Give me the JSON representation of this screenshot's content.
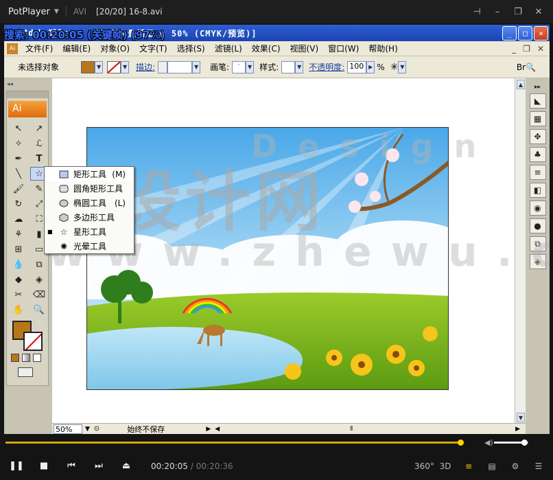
{
  "player": {
    "app_name": "PotPlayer",
    "format": "AVI",
    "file": "[20/20] 16-8.avi",
    "osd": "搜索: 00:20:05 (关键帧) (97%)",
    "current_time": "00:20:05",
    "duration": "/ 00:20:36",
    "progress": 0.975,
    "volume": 0.88,
    "button_3d": "3D",
    "button_360": "360°"
  },
  "ai": {
    "title": "[春季风景插画 @ 50% (CMYK/预览)]",
    "title_prefix": "Adob  Illu",
    "menu": [
      "文件(F)",
      "编辑(E)",
      "对象(O)",
      "文字(T)",
      "选择(S)",
      "滤镜(L)",
      "效果(C)",
      "视图(V)",
      "窗口(W)",
      "帮助(H)"
    ],
    "control": {
      "no_selection": "未选择对象",
      "stroke_label": "描边:",
      "brush_label": "画笔:",
      "style_label": "样式:",
      "opacity_label": "不透明度:",
      "opacity_value": "100",
      "percent": "%"
    },
    "toolbox_label": "Ai",
    "popup": [
      {
        "label": "矩形工具",
        "shortcut": "(M)",
        "icon": "rectangle-icon",
        "bullet": ""
      },
      {
        "label": "圆角矩形工具",
        "shortcut": "",
        "icon": "rounded-rectangle-icon",
        "bullet": ""
      },
      {
        "label": "椭圆工具",
        "shortcut": "(L)",
        "icon": "ellipse-icon",
        "bullet": ""
      },
      {
        "label": "多边形工具",
        "shortcut": "",
        "icon": "polygon-icon",
        "bullet": ""
      },
      {
        "label": "星形工具",
        "shortcut": "",
        "icon": "star-icon",
        "bullet": "■"
      },
      {
        "label": "光晕工具",
        "shortcut": "",
        "icon": "flare-icon",
        "bullet": ""
      }
    ],
    "status": {
      "zoom": "50%",
      "save_state": "始终不保存"
    }
  },
  "watermark": {
    "big": "展设计网",
    "url": "www.zhewu.com",
    "design": "Design"
  },
  "colors": {
    "player_bg": "#141414",
    "seek": "#d4a800",
    "ai_title": "#2d5fd2",
    "ui_gray": "#ece9d8",
    "fill_swatch": "#b8761a"
  }
}
